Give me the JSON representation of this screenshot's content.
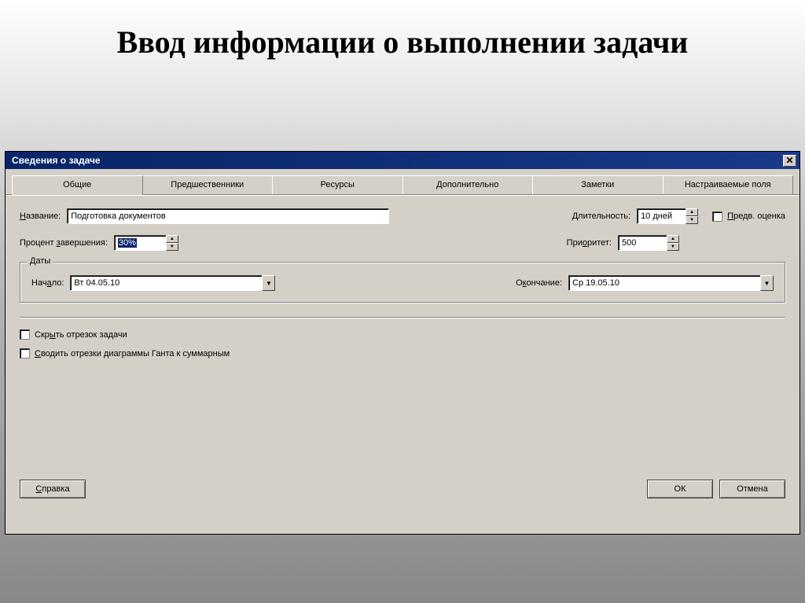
{
  "page_title": "Ввод информации о выполнении задачи",
  "dialog": {
    "title": "Сведения о задаче",
    "tabs": [
      {
        "label": "Общие"
      },
      {
        "label": "Предшественники"
      },
      {
        "label": "Ресурсы"
      },
      {
        "label": "Дополнительно"
      },
      {
        "label": "Заметки"
      },
      {
        "label": "Настраиваемые поля"
      }
    ],
    "name_label": "Название:",
    "name_value": "Подготовка документов",
    "duration_label": "Длительность:",
    "duration_value": "10 дней",
    "estimate_label": "Предв. оценка",
    "percent_label": "Процент завершения:",
    "percent_value": "30%",
    "priority_label": "Приоритет:",
    "priority_value": "500",
    "dates_legend": "Даты",
    "start_label": "Начало:",
    "start_value": "Вт 04.05.10",
    "end_label": "Окончание:",
    "end_value": "Ср 19.05.10",
    "hide_bar_label": "Скрыть отрезок задачи",
    "rollup_label": "Сводить отрезки диаграммы Ганта к суммарным",
    "help_button": "Справка",
    "ok_button": "ОК",
    "cancel_button": "Отмена"
  }
}
